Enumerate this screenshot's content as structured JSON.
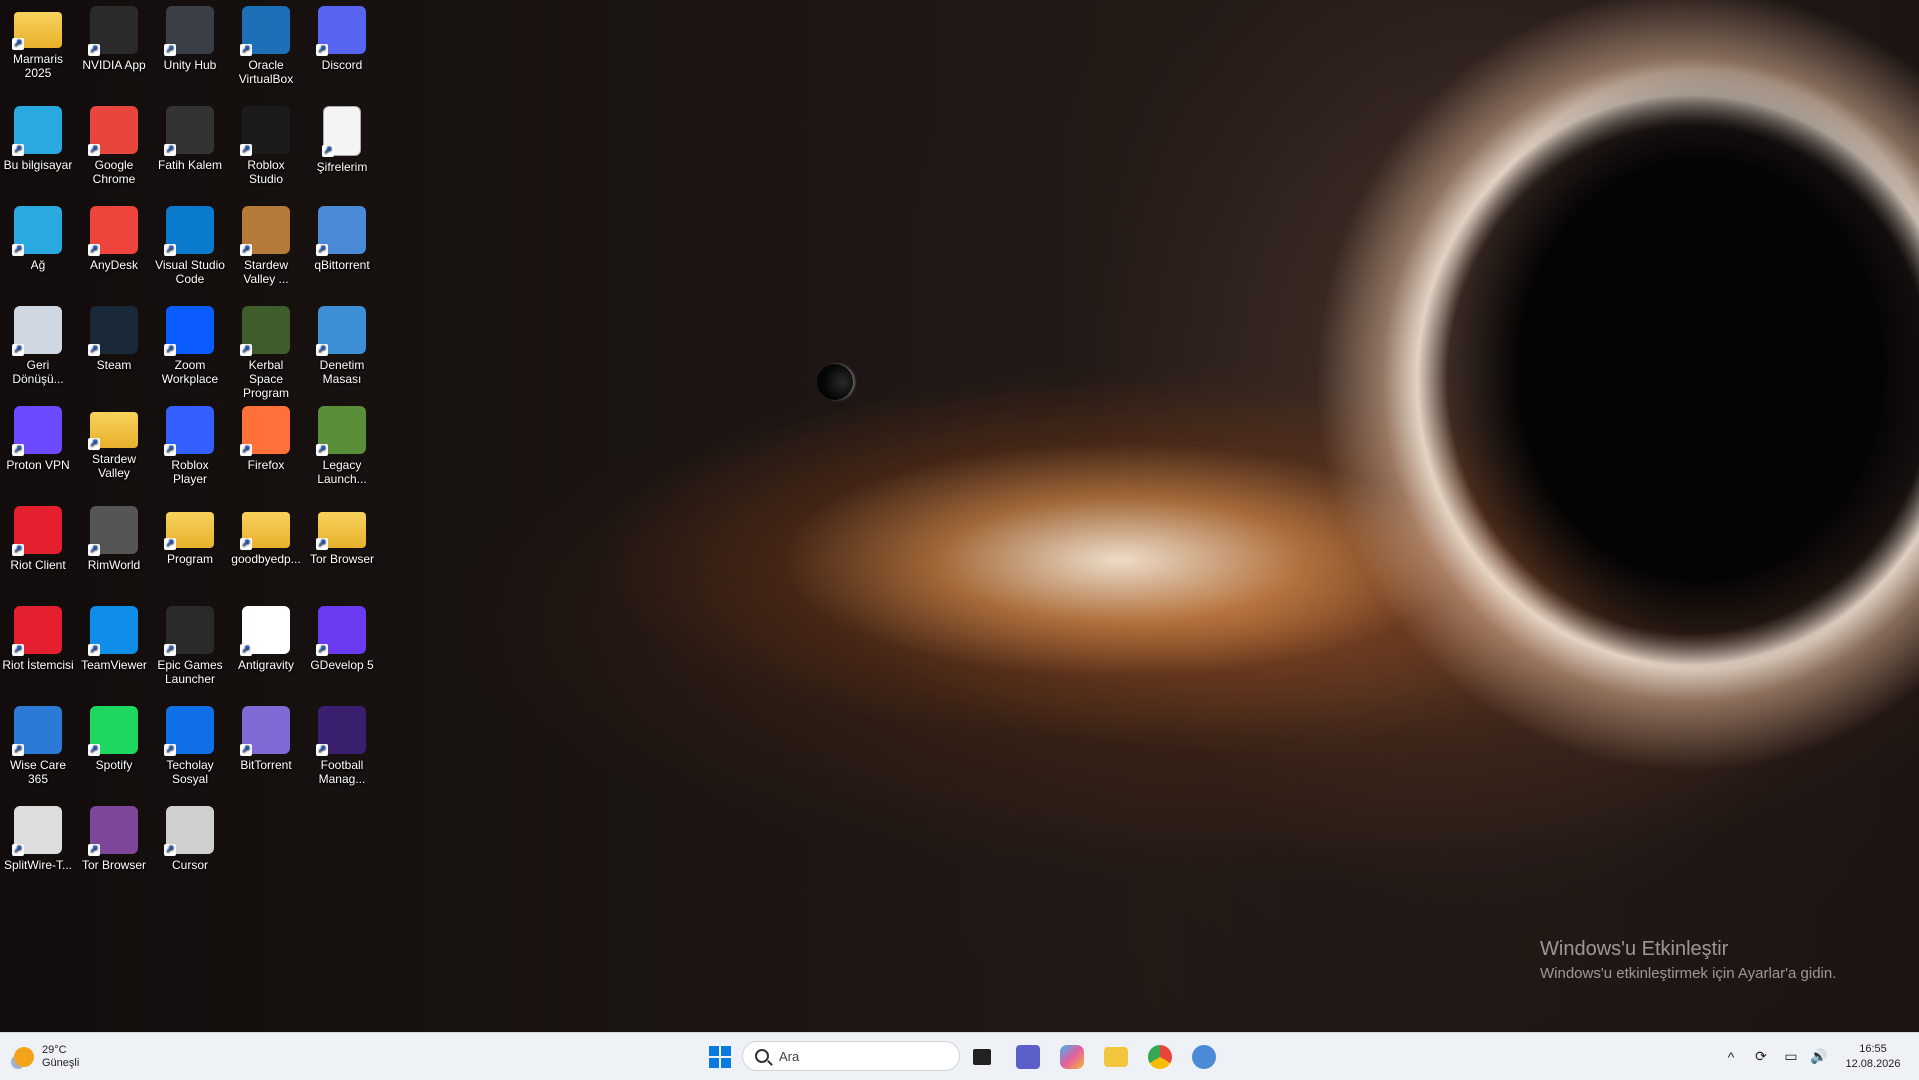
{
  "desktop_icons": [
    {
      "label": "Marmaris\n2025",
      "icon": "folder-icon",
      "color": "#f2c53d"
    },
    {
      "label": "NVIDIA App",
      "icon": "nvidia-icon",
      "color": "#2a2a2a"
    },
    {
      "label": "Unity Hub",
      "icon": "unity-icon",
      "color": "#3a3f47"
    },
    {
      "label": "Oracle VirtualBox",
      "icon": "virtualbox-icon",
      "color": "#1d6fb8"
    },
    {
      "label": "Discord",
      "icon": "discord-icon",
      "color": "#5865f2"
    },
    {
      "label": "Bu bilgisayar",
      "icon": "computer-icon",
      "color": "#2aa9e0"
    },
    {
      "label": "Google Chrome",
      "icon": "chrome-icon",
      "color": "#e8453c"
    },
    {
      "label": "Fatih Kalem",
      "icon": "pen-icon",
      "color": "#333333"
    },
    {
      "label": "Roblox Studio",
      "icon": "roblox-studio-icon",
      "color": "#1b1b1b"
    },
    {
      "label": "Şifrelerim",
      "icon": "text-file-icon",
      "color": "#f4f4f4"
    },
    {
      "label": "Ağ",
      "icon": "network-icon",
      "color": "#2aa9e0"
    },
    {
      "label": "AnyDesk",
      "icon": "anydesk-icon",
      "color": "#ef443b"
    },
    {
      "label": "Visual Studio Code",
      "icon": "vscode-icon",
      "color": "#0a7acc"
    },
    {
      "label": "Stardew Valley ...",
      "icon": "stardew-icon",
      "color": "#b5793a"
    },
    {
      "label": "qBittorrent",
      "icon": "qbittorrent-icon",
      "color": "#4b8ad6"
    },
    {
      "label": "Geri Dönüşü...",
      "icon": "recycle-bin-icon",
      "color": "#cfd8e2"
    },
    {
      "label": "Steam",
      "icon": "steam-icon",
      "color": "#1b2838"
    },
    {
      "label": "Zoom Workplace",
      "icon": "zoom-icon",
      "color": "#0b5cff"
    },
    {
      "label": "Kerbal Space Program",
      "icon": "kerbal-icon",
      "color": "#3e5d2a"
    },
    {
      "label": "Denetim Masası",
      "icon": "control-panel-icon",
      "color": "#3d8fd6"
    },
    {
      "label": "Proton VPN",
      "icon": "protonvpn-icon",
      "color": "#6d4aff"
    },
    {
      "label": "Stardew Valley",
      "icon": "folder-icon",
      "color": "#f2c53d"
    },
    {
      "label": "Roblox Player",
      "icon": "roblox-icon",
      "color": "#335fff"
    },
    {
      "label": "Firefox",
      "icon": "firefox-icon",
      "color": "#ff7139"
    },
    {
      "label": "Legacy Launch...",
      "icon": "minecraft-icon",
      "color": "#5a8f3a"
    },
    {
      "label": "Riot Client",
      "icon": "riot-icon",
      "color": "#e4202e"
    },
    {
      "label": "RimWorld",
      "icon": "rimworld-icon",
      "color": "#555555"
    },
    {
      "label": "Program",
      "icon": "folder-icon",
      "color": "#f2c53d"
    },
    {
      "label": "goodbyedp...",
      "icon": "folder-icon",
      "color": "#f2c53d"
    },
    {
      "label": "Tor Browser",
      "icon": "folder-icon",
      "color": "#f2c53d"
    },
    {
      "label": "Riot İstemcisi",
      "icon": "riot-icon",
      "color": "#e4202e"
    },
    {
      "label": "TeamViewer",
      "icon": "teamviewer-icon",
      "color": "#0e8ee9"
    },
    {
      "label": "Epic Games Launcher",
      "icon": "epic-icon",
      "color": "#2a2a2a"
    },
    {
      "label": "Antigravity",
      "icon": "antigravity-icon",
      "color": "#ffffff"
    },
    {
      "label": "GDevelop 5",
      "icon": "gdevelop-icon",
      "color": "#6b3bf2"
    },
    {
      "label": "Wise Care 365",
      "icon": "wisecare-icon",
      "color": "#2b7bd6"
    },
    {
      "label": "Spotify",
      "icon": "spotify-icon",
      "color": "#1ed760"
    },
    {
      "label": "Techolay Sosyal",
      "icon": "techolay-icon",
      "color": "#1070e8"
    },
    {
      "label": "BitTorrent",
      "icon": "bittorrent-icon",
      "color": "#7f6ad6"
    },
    {
      "label": "Football Manag...",
      "icon": "football-manager-icon",
      "color": "#3a1f6e"
    },
    {
      "label": "SplitWire-T...",
      "icon": "splitwire-icon",
      "color": "#dddddd"
    },
    {
      "label": "Tor Browser",
      "icon": "tor-icon",
      "color": "#7d4698"
    },
    {
      "label": "Cursor",
      "icon": "cursor-icon",
      "color": "#cfcfcf"
    }
  ],
  "watermark": {
    "title": "Windows'u Etkinleştir",
    "subtitle": "Windows'u etkinleştirmek için Ayarlar'a gidin."
  },
  "taskbar": {
    "weather_temp": "29°C",
    "weather_desc": "Güneşli",
    "search_placeholder": "Ara",
    "pinned": [
      {
        "name": "start-button",
        "color": "#0a7ae0"
      },
      {
        "name": "task-view",
        "color": "#222222"
      },
      {
        "name": "teams",
        "color": "#5b5fc7"
      },
      {
        "name": "copilot",
        "color": "#e25fa0"
      },
      {
        "name": "file-explorer",
        "color": "#f2c53d"
      },
      {
        "name": "chrome",
        "color": "#e8453c"
      },
      {
        "name": "qbittorrent",
        "color": "#4b8ad6"
      }
    ],
    "time": "16:55",
    "date": "12.08.2026"
  }
}
